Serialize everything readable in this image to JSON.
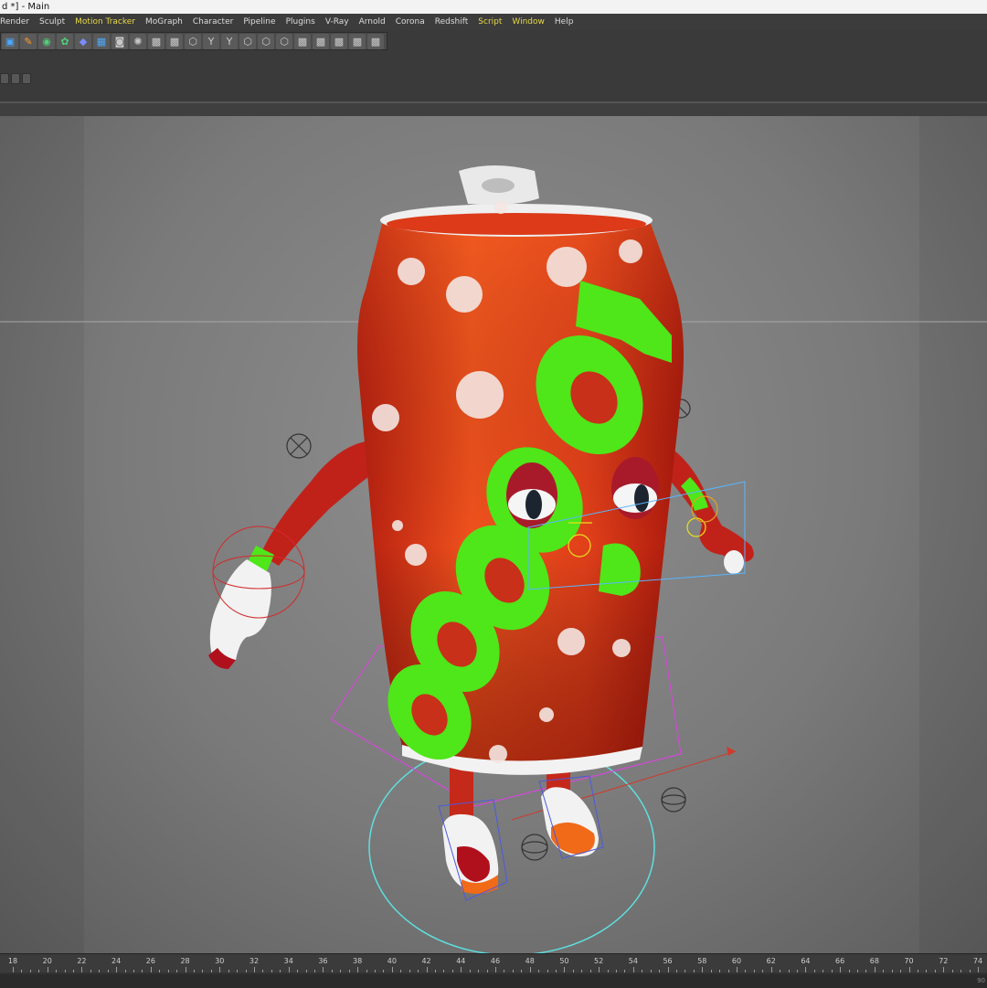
{
  "window": {
    "title": "d *] - Main"
  },
  "menu": [
    {
      "label": "Render",
      "highlight": false
    },
    {
      "label": "Sculpt",
      "highlight": false
    },
    {
      "label": "Motion Tracker",
      "highlight": true
    },
    {
      "label": "MoGraph",
      "highlight": false
    },
    {
      "label": "Character",
      "highlight": false
    },
    {
      "label": "Pipeline",
      "highlight": false
    },
    {
      "label": "Plugins",
      "highlight": false
    },
    {
      "label": "V-Ray",
      "highlight": false
    },
    {
      "label": "Arnold",
      "highlight": false
    },
    {
      "label": "Corona",
      "highlight": false
    },
    {
      "label": "Redshift",
      "highlight": false
    },
    {
      "label": "Script",
      "highlight": true
    },
    {
      "label": "Window",
      "highlight": true
    },
    {
      "label": "Help",
      "highlight": false
    }
  ],
  "toolbar": {
    "tools": [
      "cube-icon",
      "pen-icon",
      "subdivide-icon",
      "cloner-icon",
      "deformer-icon",
      "floor-icon",
      "camera-icon",
      "light-icon",
      "grid-icon",
      "grid-icon",
      "box-icon",
      "axis-icon",
      "axis-icon",
      "box-icon",
      "box-icon",
      "box-icon",
      "grid-icon",
      "grid-icon",
      "grid-icon",
      "grid-icon",
      "grid-icon"
    ]
  },
  "model": {
    "label_text": "COOOOL D",
    "can_color": "#e8461c",
    "label_color": "#4fe61a"
  },
  "timeline": {
    "ticks": [
      "18",
      "20",
      "22",
      "24",
      "26",
      "28",
      "30",
      "32",
      "34",
      "36",
      "38",
      "40",
      "42",
      "44",
      "46",
      "48",
      "50",
      "52",
      "54",
      "56",
      "58",
      "60",
      "62",
      "64",
      "66",
      "68",
      "70",
      "72",
      "74"
    ],
    "end_value": "90"
  }
}
